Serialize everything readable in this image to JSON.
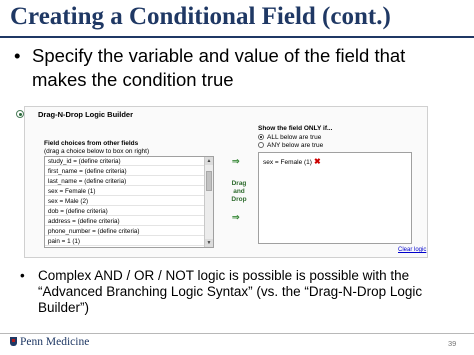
{
  "slide": {
    "title": "Creating a Conditional Field (cont.)",
    "bullet1": "Specify the variable and value of the field that makes the condition true",
    "bullet2": "Complex AND / OR / NOT logic is possible is possible with the “Advanced Branching Logic Syntax” (vs. the “Drag-N-Drop Logic Builder”)",
    "bullet_char": "•",
    "page_number": "39"
  },
  "builder": {
    "title": "Drag-N-Drop Logic Builder",
    "left_heading": "Field choices from other fields",
    "left_subheading": "(drag a choice below to box on right)",
    "fields": [
      "study_id = (define criteria)",
      "first_name = (define criteria)",
      "last_name = (define criteria)",
      "sex = Female (1)",
      "sex = Male (2)",
      "dob = (define criteria)",
      "address = (define criteria)",
      "phone_number = (define criteria)",
      "pain = 1 (1)"
    ],
    "drag_drop_label": [
      "Drag",
      "and",
      "Drop"
    ],
    "arrow_glyph": "⇒",
    "right_heading": "Show the field ONLY if...",
    "option_all": "ALL below are true",
    "option_any": "ANY below are true",
    "selected_option": "ALL below are true",
    "condition_item": "sex = Female (1)",
    "remove_icon_glyph": "✖",
    "clear_logic": "Clear logic"
  },
  "footer": {
    "logo_text": "Penn Medicine"
  },
  "colors": {
    "title": "#1f3864",
    "accent_green": "#3a8a3a",
    "remove_red": "#cc0000",
    "link": "#0000cc"
  }
}
